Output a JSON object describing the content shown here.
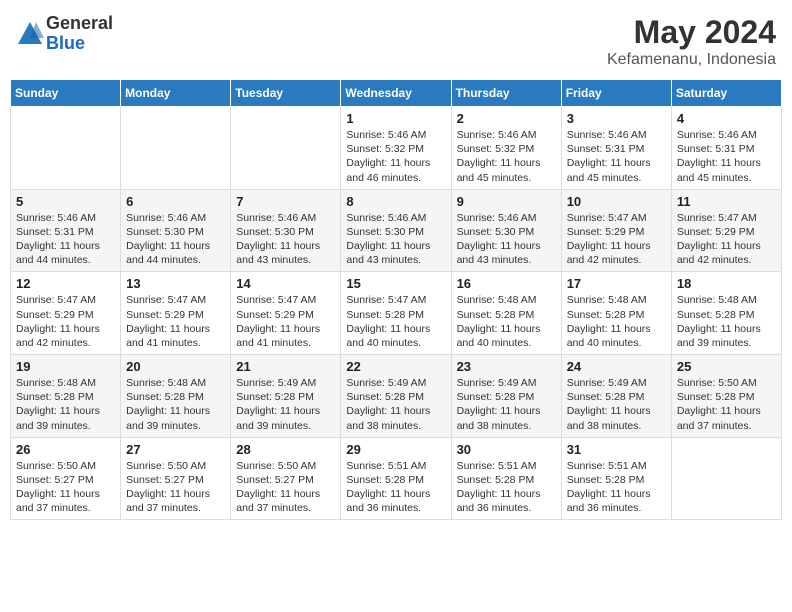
{
  "logo": {
    "general": "General",
    "blue": "Blue"
  },
  "title": "May 2024",
  "subtitle": "Kefamenanu, Indonesia",
  "days_of_week": [
    "Sunday",
    "Monday",
    "Tuesday",
    "Wednesday",
    "Thursday",
    "Friday",
    "Saturday"
  ],
  "weeks": [
    [
      {
        "day": "",
        "info": ""
      },
      {
        "day": "",
        "info": ""
      },
      {
        "day": "",
        "info": ""
      },
      {
        "day": "1",
        "info": "Sunrise: 5:46 AM\nSunset: 5:32 PM\nDaylight: 11 hours and 46 minutes."
      },
      {
        "day": "2",
        "info": "Sunrise: 5:46 AM\nSunset: 5:32 PM\nDaylight: 11 hours and 45 minutes."
      },
      {
        "day": "3",
        "info": "Sunrise: 5:46 AM\nSunset: 5:31 PM\nDaylight: 11 hours and 45 minutes."
      },
      {
        "day": "4",
        "info": "Sunrise: 5:46 AM\nSunset: 5:31 PM\nDaylight: 11 hours and 45 minutes."
      }
    ],
    [
      {
        "day": "5",
        "info": "Sunrise: 5:46 AM\nSunset: 5:31 PM\nDaylight: 11 hours and 44 minutes."
      },
      {
        "day": "6",
        "info": "Sunrise: 5:46 AM\nSunset: 5:30 PM\nDaylight: 11 hours and 44 minutes."
      },
      {
        "day": "7",
        "info": "Sunrise: 5:46 AM\nSunset: 5:30 PM\nDaylight: 11 hours and 43 minutes."
      },
      {
        "day": "8",
        "info": "Sunrise: 5:46 AM\nSunset: 5:30 PM\nDaylight: 11 hours and 43 minutes."
      },
      {
        "day": "9",
        "info": "Sunrise: 5:46 AM\nSunset: 5:30 PM\nDaylight: 11 hours and 43 minutes."
      },
      {
        "day": "10",
        "info": "Sunrise: 5:47 AM\nSunset: 5:29 PM\nDaylight: 11 hours and 42 minutes."
      },
      {
        "day": "11",
        "info": "Sunrise: 5:47 AM\nSunset: 5:29 PM\nDaylight: 11 hours and 42 minutes."
      }
    ],
    [
      {
        "day": "12",
        "info": "Sunrise: 5:47 AM\nSunset: 5:29 PM\nDaylight: 11 hours and 42 minutes."
      },
      {
        "day": "13",
        "info": "Sunrise: 5:47 AM\nSunset: 5:29 PM\nDaylight: 11 hours and 41 minutes."
      },
      {
        "day": "14",
        "info": "Sunrise: 5:47 AM\nSunset: 5:29 PM\nDaylight: 11 hours and 41 minutes."
      },
      {
        "day": "15",
        "info": "Sunrise: 5:47 AM\nSunset: 5:28 PM\nDaylight: 11 hours and 40 minutes."
      },
      {
        "day": "16",
        "info": "Sunrise: 5:48 AM\nSunset: 5:28 PM\nDaylight: 11 hours and 40 minutes."
      },
      {
        "day": "17",
        "info": "Sunrise: 5:48 AM\nSunset: 5:28 PM\nDaylight: 11 hours and 40 minutes."
      },
      {
        "day": "18",
        "info": "Sunrise: 5:48 AM\nSunset: 5:28 PM\nDaylight: 11 hours and 39 minutes."
      }
    ],
    [
      {
        "day": "19",
        "info": "Sunrise: 5:48 AM\nSunset: 5:28 PM\nDaylight: 11 hours and 39 minutes."
      },
      {
        "day": "20",
        "info": "Sunrise: 5:48 AM\nSunset: 5:28 PM\nDaylight: 11 hours and 39 minutes."
      },
      {
        "day": "21",
        "info": "Sunrise: 5:49 AM\nSunset: 5:28 PM\nDaylight: 11 hours and 39 minutes."
      },
      {
        "day": "22",
        "info": "Sunrise: 5:49 AM\nSunset: 5:28 PM\nDaylight: 11 hours and 38 minutes."
      },
      {
        "day": "23",
        "info": "Sunrise: 5:49 AM\nSunset: 5:28 PM\nDaylight: 11 hours and 38 minutes."
      },
      {
        "day": "24",
        "info": "Sunrise: 5:49 AM\nSunset: 5:28 PM\nDaylight: 11 hours and 38 minutes."
      },
      {
        "day": "25",
        "info": "Sunrise: 5:50 AM\nSunset: 5:28 PM\nDaylight: 11 hours and 37 minutes."
      }
    ],
    [
      {
        "day": "26",
        "info": "Sunrise: 5:50 AM\nSunset: 5:27 PM\nDaylight: 11 hours and 37 minutes."
      },
      {
        "day": "27",
        "info": "Sunrise: 5:50 AM\nSunset: 5:27 PM\nDaylight: 11 hours and 37 minutes."
      },
      {
        "day": "28",
        "info": "Sunrise: 5:50 AM\nSunset: 5:27 PM\nDaylight: 11 hours and 37 minutes."
      },
      {
        "day": "29",
        "info": "Sunrise: 5:51 AM\nSunset: 5:28 PM\nDaylight: 11 hours and 36 minutes."
      },
      {
        "day": "30",
        "info": "Sunrise: 5:51 AM\nSunset: 5:28 PM\nDaylight: 11 hours and 36 minutes."
      },
      {
        "day": "31",
        "info": "Sunrise: 5:51 AM\nSunset: 5:28 PM\nDaylight: 11 hours and 36 minutes."
      },
      {
        "day": "",
        "info": ""
      }
    ]
  ]
}
